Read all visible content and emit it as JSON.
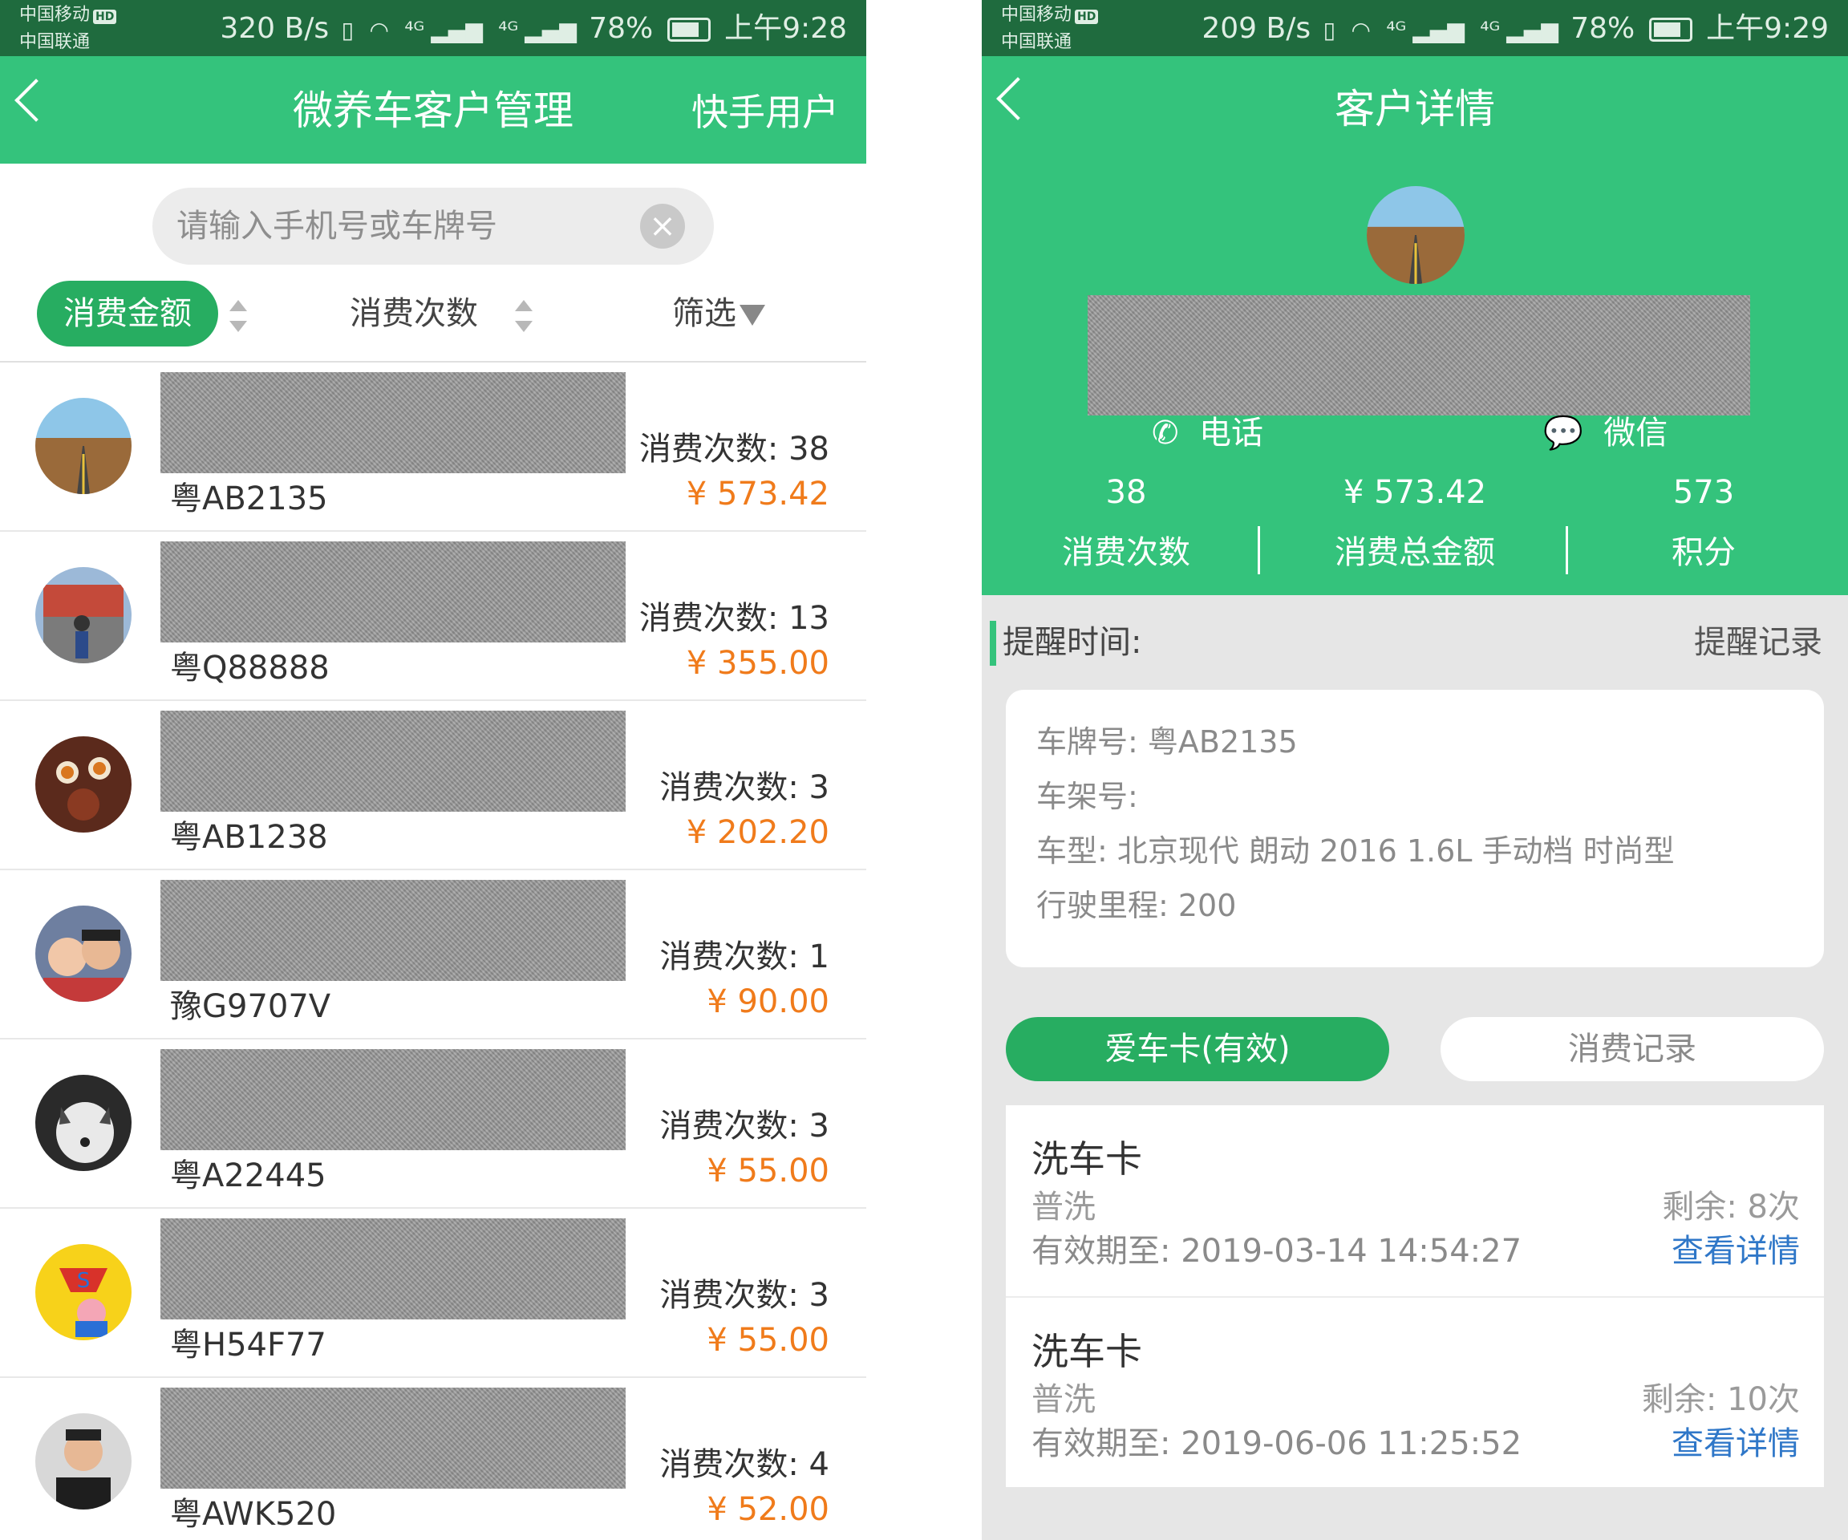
{
  "colors": {
    "brand_green": "#34c37c",
    "pill_green": "#27ad61",
    "status_green": "#1f6b3e",
    "amount_orange": "#f07b1b",
    "link_blue": "#2f77c8"
  },
  "left": {
    "status": {
      "carrier1": "中国移动",
      "carrier2": "中国联通",
      "hd": "HD",
      "speed": "320 B/s",
      "net1": "⁴ᴳ",
      "net2": "⁴ᴳ",
      "battery": "78%",
      "time": "上午9:28"
    },
    "header": {
      "title": "微养车客户管理",
      "right_action": "快手用户"
    },
    "search": {
      "placeholder": "请输入手机号或车牌号",
      "clear_icon": "×"
    },
    "sort": {
      "amount": "消费金额",
      "count": "消费次数",
      "filter": "筛选"
    },
    "customers": [
      {
        "plate": "粤AB2135",
        "count": "消费次数: 38",
        "amount": "¥ 573.42",
        "avatar": "road-landscape"
      },
      {
        "plate": "粤Q88888",
        "count": "消费次数: 13",
        "amount": "¥ 355.00",
        "avatar": "palace-bike"
      },
      {
        "plate": "粤AB1238",
        "count": "消费次数: 3",
        "amount": "¥ 202.20",
        "avatar": "tea-set"
      },
      {
        "plate": "豫G9707V",
        "count": "消费次数: 1",
        "amount": "¥ 90.00",
        "avatar": "couple"
      },
      {
        "plate": "粤A22445",
        "count": "消费次数: 3",
        "amount": "¥ 55.00",
        "avatar": "husky-dog"
      },
      {
        "plate": "粤H54F77",
        "count": "消费次数: 3",
        "amount": "¥ 55.00",
        "avatar": "superhero-cartoon"
      },
      {
        "plate": "粤AWK520",
        "count": "消费次数: 4",
        "amount": "¥ 52.00",
        "avatar": "young-man"
      }
    ]
  },
  "right": {
    "status": {
      "carrier1": "中国移动",
      "carrier2": "中国联通",
      "hd": "HD",
      "speed": "209 B/s",
      "net1": "⁴ᴳ",
      "net2": "⁴ᴳ",
      "battery": "78%",
      "time": "上午9:29"
    },
    "header": {
      "title": "客户详情"
    },
    "contact": {
      "phone": "电话",
      "wechat": "微信"
    },
    "stats": [
      {
        "value": "38",
        "label": "消费次数"
      },
      {
        "value": "¥ 573.42",
        "label": "消费总金额"
      },
      {
        "value": "573",
        "label": "积分"
      }
    ],
    "reminder": {
      "label": "提醒时间:",
      "link": "提醒记录"
    },
    "car": {
      "plate": "车牌号: 粤AB2135",
      "frame": "车架号:",
      "model": "车型: 北京现代 朗动 2016 1.6L 手动档 时尚型",
      "mileage": "行驶里程: 200"
    },
    "tabs": {
      "active": "爱车卡(有效)",
      "inactive": "消费记录"
    },
    "cards": [
      {
        "title": "洗车卡",
        "type": "普洗",
        "expiry": "有效期至: 2019-03-14 14:54:27",
        "remaining": "剩余: 8次",
        "link": "查看详情"
      },
      {
        "title": "洗车卡",
        "type": "普洗",
        "expiry": "有效期至: 2019-06-06 11:25:52",
        "remaining": "剩余: 10次",
        "link": "查看详情"
      }
    ]
  }
}
